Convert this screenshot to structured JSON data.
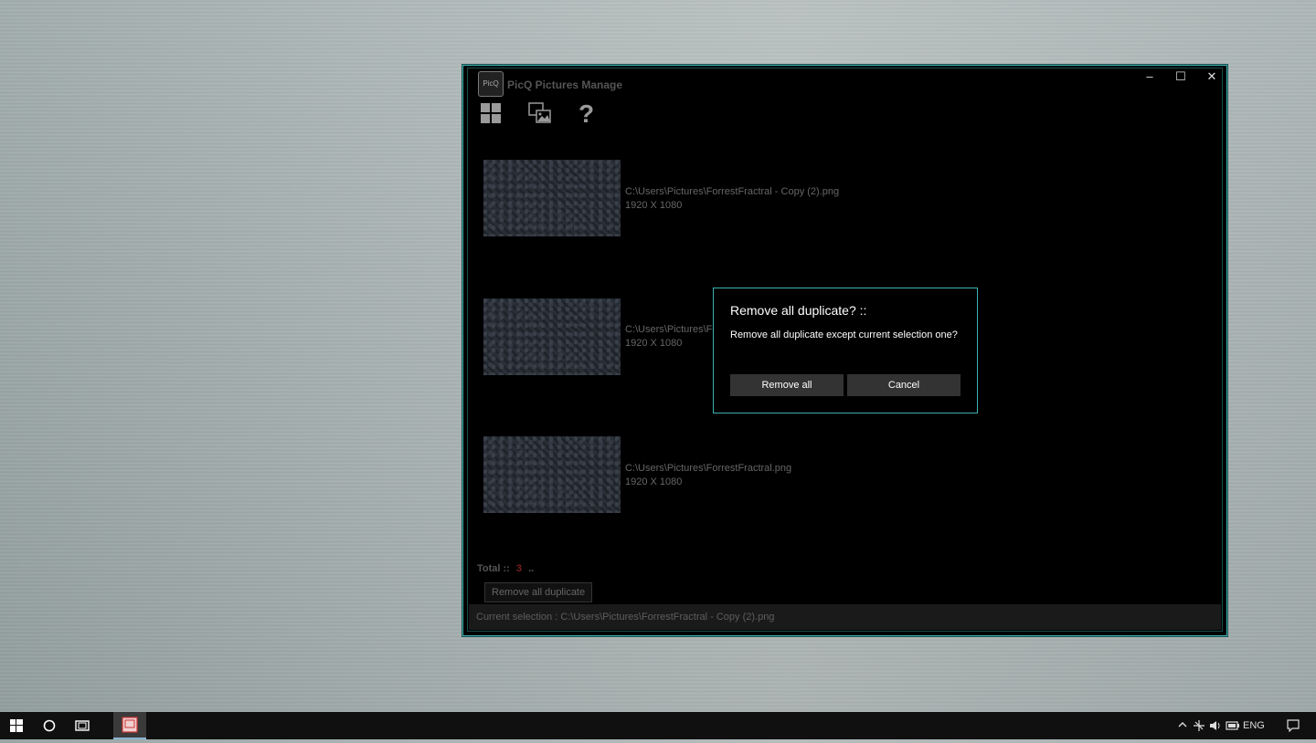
{
  "window": {
    "title": "PicQ Pictures Manage",
    "logo_text": "PicQ",
    "controls": {
      "minimize": "–",
      "maximize": "☐",
      "close": "✕"
    }
  },
  "toolbar": {
    "icons": [
      "grid-icon",
      "pictures-compare-icon",
      "help-icon"
    ],
    "help_glyph": "?"
  },
  "items": [
    {
      "path": "C:\\Users\\Pictures\\ForrestFractral - Copy (2).png",
      "size": "1920 X 1080"
    },
    {
      "path": "C:\\Users\\Pictures\\Fo",
      "size": "1920 X 1080"
    },
    {
      "path": "C:\\Users\\Pictures\\ForrestFractral.png",
      "size": "1920 X 1080"
    }
  ],
  "footer": {
    "total_label": "Total ::",
    "total_value": "3",
    "total_suffix": "..",
    "remove_all_duplicate_label": "Remove all duplicate",
    "current_selection": "Current selection : C:\\Users\\Pictures\\ForrestFractral - Copy (2).png"
  },
  "dialog": {
    "title": "Remove all duplicate? ::",
    "message": "Remove all duplicate except current selection one?",
    "primary_label": "Remove all",
    "cancel_label": "Cancel"
  },
  "taskbar": {
    "tray_lang": "ENG"
  },
  "colors": {
    "accent": "#3fb0b0",
    "total_value": "#7a1e1e"
  }
}
